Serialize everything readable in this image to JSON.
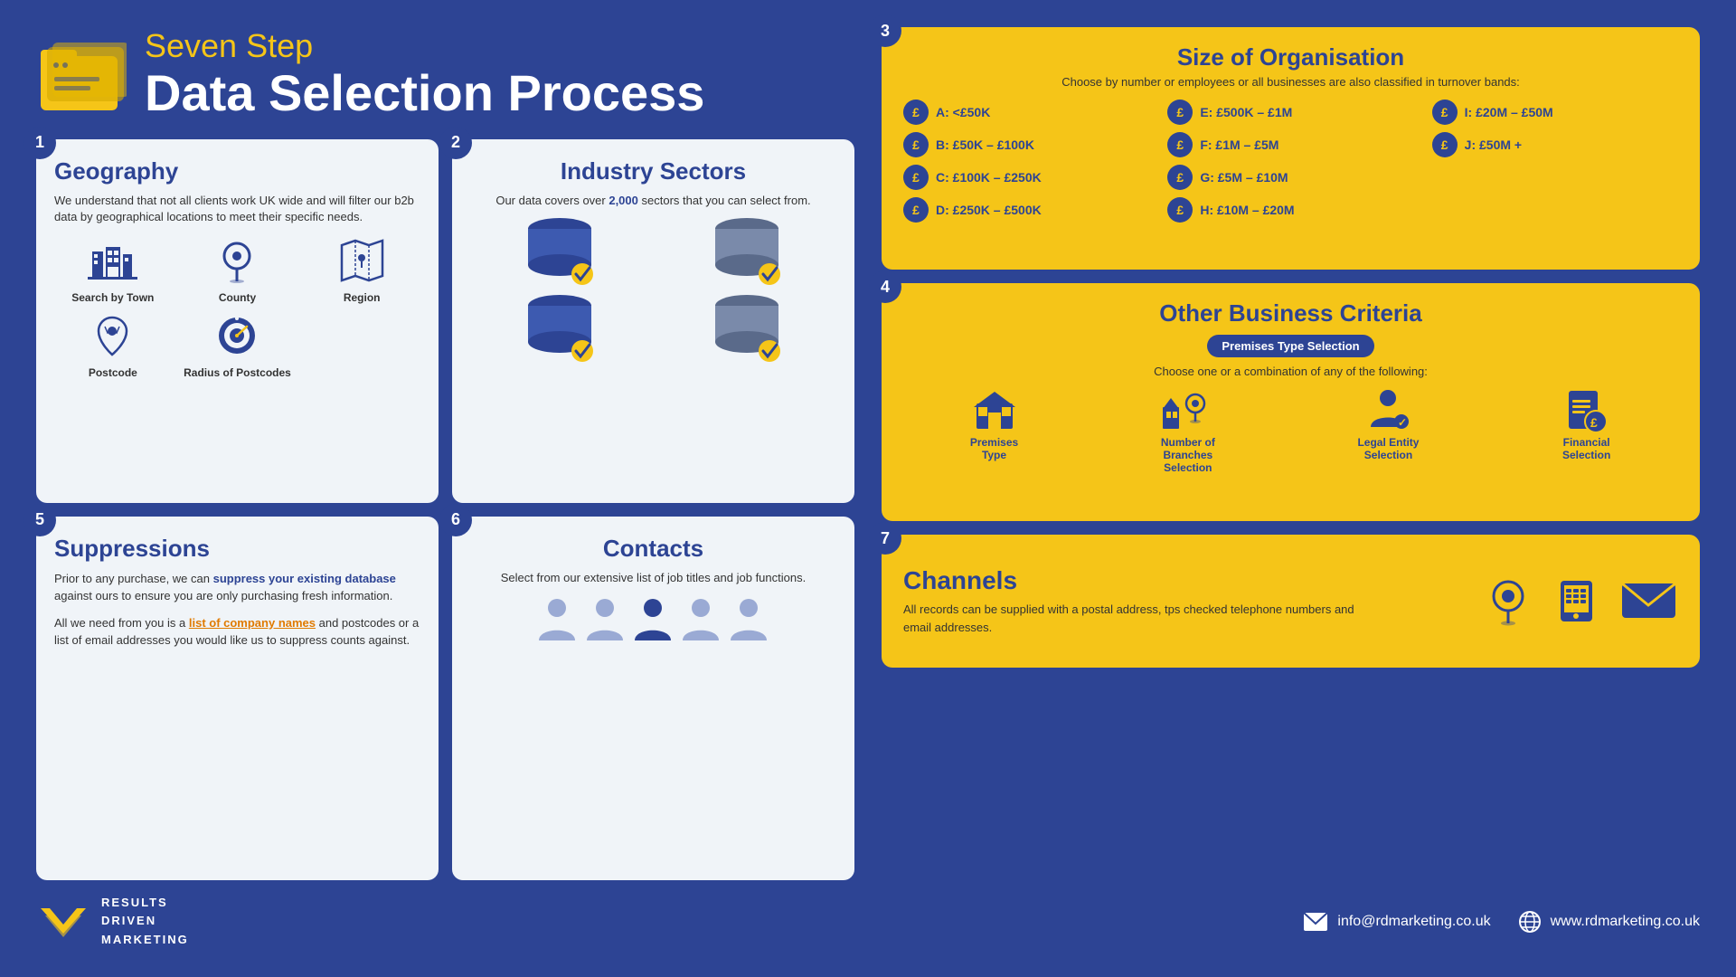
{
  "header": {
    "subtitle": "Seven Step",
    "title": "Data Selection Process"
  },
  "steps": {
    "step1": {
      "badge": "1",
      "title": "Geography",
      "description": "We understand that not all clients work UK wide and will filter our b2b data by geographical locations to meet their specific needs.",
      "items": [
        {
          "label": "Search by Town",
          "icon": "building"
        },
        {
          "label": "County",
          "icon": "location"
        },
        {
          "label": "Region",
          "icon": "region"
        },
        {
          "label": "Postcode",
          "icon": "postcode"
        },
        {
          "label": "Radius of Postcodes",
          "icon": "radius"
        }
      ]
    },
    "step2": {
      "badge": "2",
      "title": "Industry Sectors",
      "description": "Our data covers over 2,000 sectors that you can select from.",
      "highlight": "2,000"
    },
    "step3": {
      "badge": "3",
      "title": "Size of Organisation",
      "subtitle": "Choose by number or employees or all businesses are also classified in turnover bands:",
      "items": [
        {
          "label": "A: <£50K"
        },
        {
          "label": "E: £500K – £1M"
        },
        {
          "label": "I: £20M – £50M"
        },
        {
          "label": "B: £50K – £100K"
        },
        {
          "label": "F: £1M – £5M"
        },
        {
          "label": "J: £50M +"
        },
        {
          "label": "C: £100K – £250K"
        },
        {
          "label": "G: £5M – £10M"
        },
        {
          "label": ""
        },
        {
          "label": "D: £250K – £500K"
        },
        {
          "label": "H: £10M – £20M"
        },
        {
          "label": ""
        }
      ]
    },
    "step4": {
      "badge": "4",
      "title": "Other Business Criteria",
      "badge_label": "Premises Type Selection",
      "subtitle": "Choose one or a combination of any of the following:",
      "items": [
        {
          "label": "Premises Type"
        },
        {
          "label": "Number of Branches Selection"
        },
        {
          "label": "Legal Entity Selection"
        },
        {
          "label": "Financial Selection"
        }
      ]
    },
    "step5": {
      "badge": "5",
      "title": "Suppressions",
      "para1": "Prior to any purchase, we can suppress your existing database against ours to ensure you are only purchasing fresh information.",
      "para2_start": "All we need from you is a ",
      "para2_link": "list of company names",
      "para2_end": " and postcodes or a list of email addresses you would like us to suppress counts against.",
      "highlight_text": "suppress your existing database"
    },
    "step6": {
      "badge": "6",
      "title": "Contacts",
      "description": "Select from our extensive list of job titles and job functions."
    },
    "step7": {
      "badge": "7",
      "title": "Channels",
      "description": "All records can be supplied with a postal address, tps checked telephone numbers and email addresses."
    }
  },
  "footer": {
    "logo_lines": [
      "RESULTS",
      "DRIVEN",
      "MARKETING"
    ],
    "email": "info@rdmarketing.co.uk",
    "website": "www.rdmarketing.co.uk"
  }
}
